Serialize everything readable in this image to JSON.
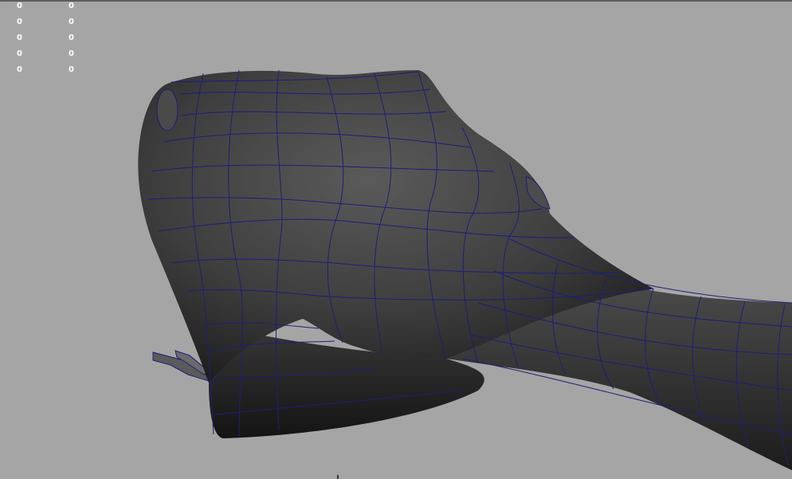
{
  "viewport": {
    "background_color": "#a5a5a5",
    "wireframe_color": "#1e1e7a",
    "surface_color": "#3f3f3f"
  },
  "hud": {
    "rows": [
      {
        "col1": "0",
        "col2": "0"
      },
      {
        "col1": "0",
        "col2": "0"
      },
      {
        "col1": "0",
        "col2": "0"
      },
      {
        "col1": "0",
        "col2": "0"
      },
      {
        "col1": "0",
        "col2": "0"
      }
    ]
  }
}
